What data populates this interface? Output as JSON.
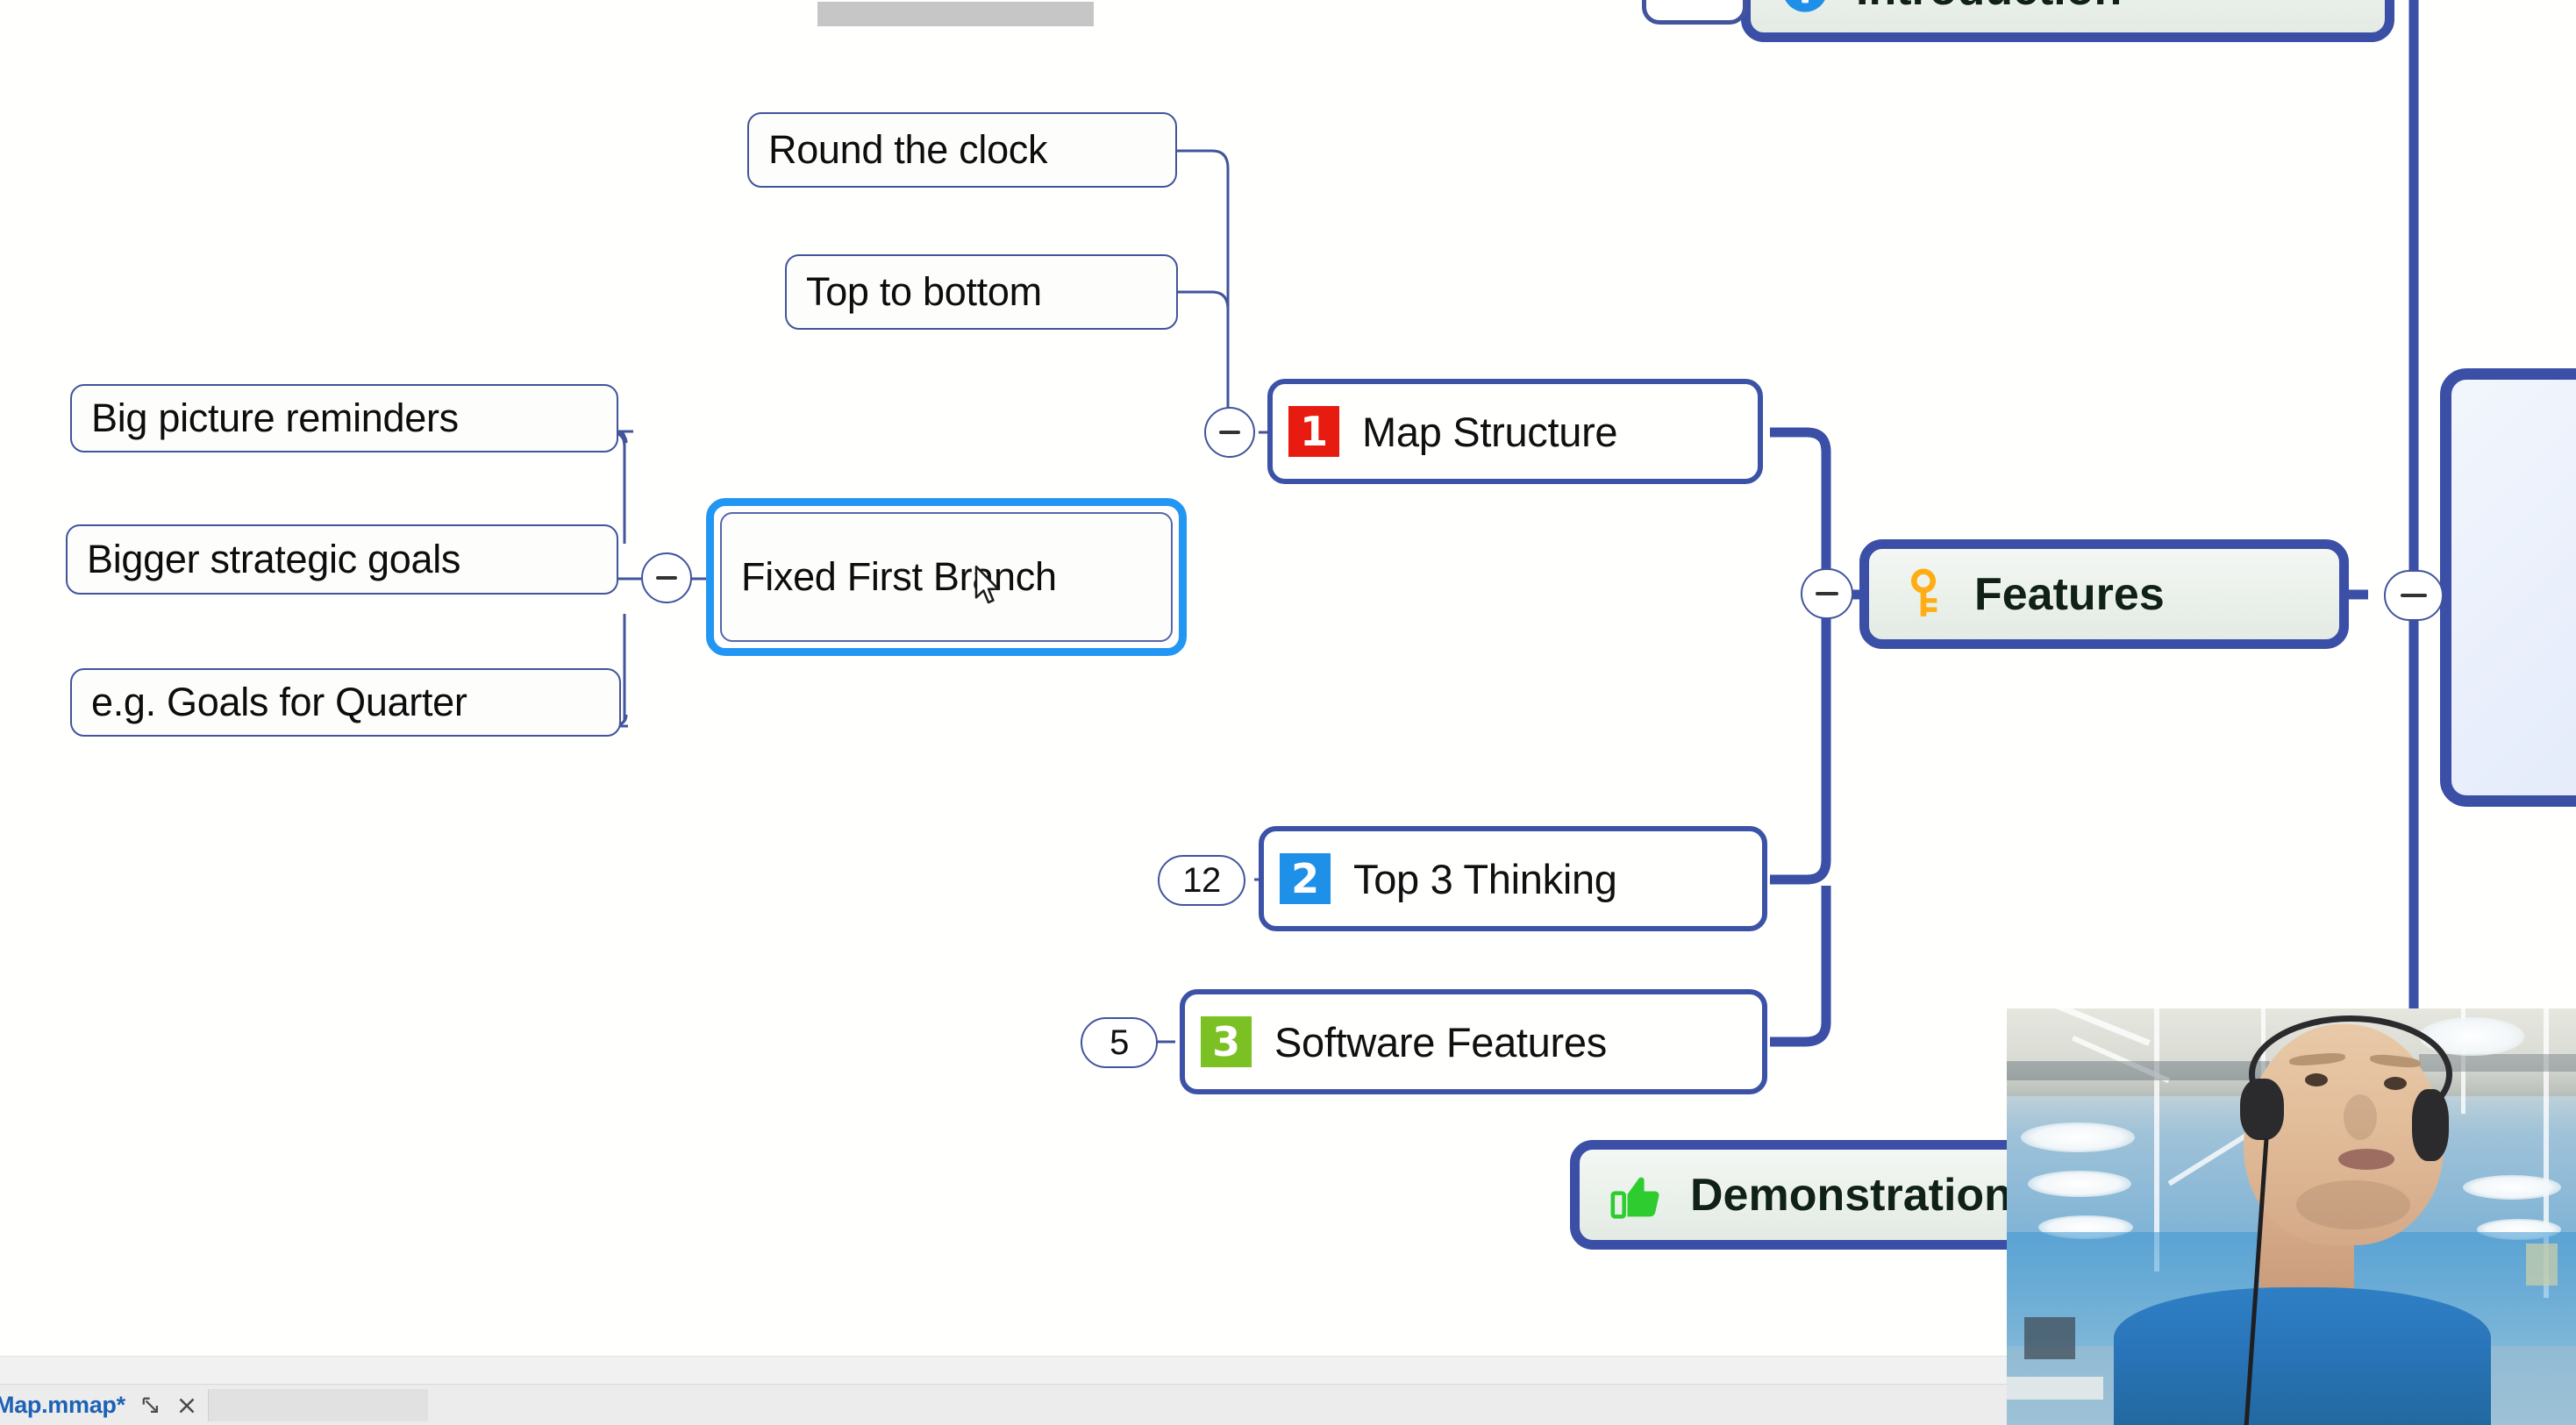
{
  "app": {
    "background_color": "#fffffd",
    "accent_blue": "#3a4fa5",
    "selection_blue": "#2196f3",
    "leaf_border": "#41549c"
  },
  "mindmap": {
    "central_topic": {
      "label": "",
      "note": "central topic node, cut off at right edge"
    },
    "branches": [
      {
        "name": "introduction-node",
        "label": "Introduction",
        "icon": "info-icon",
        "icon_color": "#1e90e8",
        "cut_off": "top"
      },
      {
        "name": "features-node",
        "label": "Features",
        "icon": "key-icon",
        "icon_color": "#ffad14"
      },
      {
        "name": "demonstration-node",
        "label": "Demonstration",
        "icon": "thumbs-up-icon",
        "icon_color": "#2ecc2e",
        "cut_off": "right"
      }
    ],
    "numbered_topics": [
      {
        "name": "map-structure-node",
        "number": "1",
        "badge_color": "#e81b10",
        "label": "Map Structure",
        "collapse_state": "expanded"
      },
      {
        "name": "top-3-thinking-node",
        "number": "2",
        "badge_color": "#1e90e8",
        "label": "Top 3 Thinking",
        "child_count": "12",
        "collapse_state": "collapsed"
      },
      {
        "name": "software-features-node",
        "number": "3",
        "badge_color": "#7bc124",
        "label": "Software Features",
        "child_count": "5",
        "collapse_state": "collapsed"
      }
    ],
    "selected_node": {
      "name": "fixed-first-branch-node",
      "label": "Fixed First Branch",
      "selected": true
    },
    "map_structure_children": [
      {
        "name": "round-the-clock-node",
        "label": "Round the clock"
      },
      {
        "name": "top-to-bottom-node",
        "label": "Top to bottom"
      }
    ],
    "fixed_first_branch_children": [
      {
        "name": "big-picture-reminders-node",
        "label": "Big picture reminders"
      },
      {
        "name": "bigger-strategic-goals-node",
        "label": "Bigger strategic goals"
      },
      {
        "name": "goals-for-quarter-node",
        "label": "e.g. Goals for Quarter"
      }
    ],
    "collapse_toggles": [
      {
        "name": "collapse-toggle-fixed-first-branch",
        "glyph": "minus"
      },
      {
        "name": "collapse-toggle-map-structure",
        "glyph": "minus"
      },
      {
        "name": "collapse-toggle-features",
        "glyph": "minus"
      },
      {
        "name": "collapse-toggle-central",
        "glyph": "minus"
      }
    ]
  },
  "webcam": {
    "name": "webcam-overlay",
    "description": "presenter wearing headset in office"
  },
  "scrollbar": {
    "name": "horizontal-scrollbar",
    "orientation": "horizontal"
  },
  "taskbar": {
    "document_tab": {
      "label": "Map.mmap*",
      "restore_icon": "restore-window-icon",
      "close_icon": "close-icon"
    }
  },
  "cursor": {
    "name": "mouse-cursor",
    "type": "arrow"
  }
}
